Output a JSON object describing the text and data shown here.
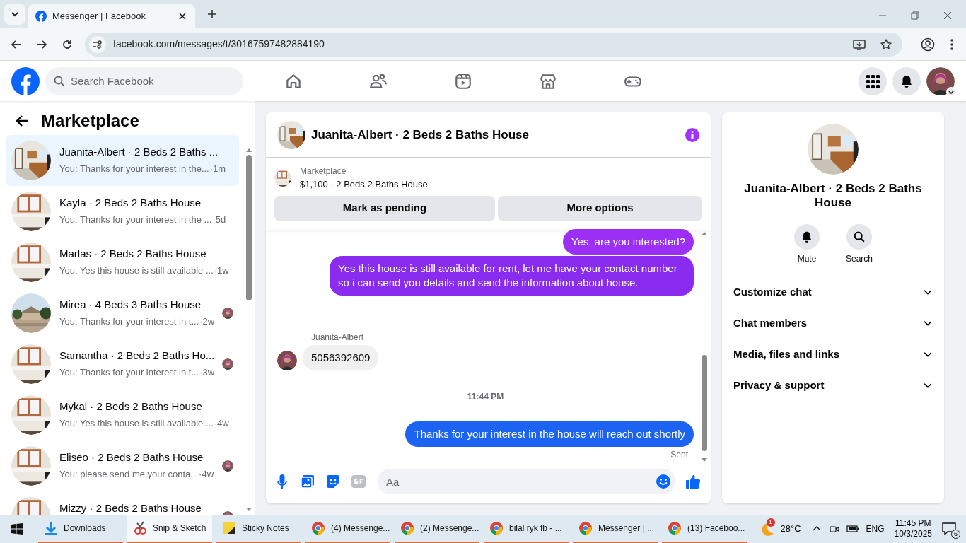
{
  "browser": {
    "tab_title": "Messenger | Facebook",
    "url": "facebook.com/messages/t/30167597482884190"
  },
  "header": {
    "search_placeholder": "Search Facebook"
  },
  "sidebar": {
    "title": "Marketplace",
    "conversations": [
      {
        "title": "Juanita-Albert · 2 Beds 2 Baths ...",
        "preview": "You: Thanks for your interest in the...",
        "time": "·1m",
        "selected": true,
        "seen_by": false
      },
      {
        "title": "Kayla · 2 Beds 2 Baths House",
        "preview": "You: Thanks for your interest in the ...",
        "time": "·5d",
        "selected": false,
        "seen_by": false
      },
      {
        "title": "Marlas · 2 Beds 2 Baths House",
        "preview": "You: Yes this house is still available ...",
        "time": "·1w",
        "selected": false,
        "seen_by": false
      },
      {
        "title": "Mirea · 4 Beds 3 Baths House",
        "preview": "You: Thanks for your interest in t...",
        "time": "·2w",
        "selected": false,
        "seen_by": true
      },
      {
        "title": "Samantha · 2 Beds 2 Baths Ho...",
        "preview": "You: Thanks for your interest in t...",
        "time": "·3w",
        "selected": false,
        "seen_by": true
      },
      {
        "title": "Mykal · 2 Beds 2 Baths House",
        "preview": "You: Yes this house is still available ...",
        "time": "·4w",
        "selected": false,
        "seen_by": false
      },
      {
        "title": "Eliseo · 2 Beds 2 Baths House",
        "preview": "You: please send me your conta...",
        "time": "·4w",
        "selected": false,
        "seen_by": true
      },
      {
        "title": "Mizzy · 2 Beds 2 Baths House",
        "selected": false,
        "seen_by": true
      }
    ]
  },
  "chat": {
    "title": "Juanita-Albert · 2 Beds 2 Baths House",
    "listing": {
      "label": "Marketplace",
      "title": "$1,100 - 2 Beds 2 Baths House"
    },
    "buttons": [
      "Mark as pending",
      "More options"
    ],
    "messages": [
      {
        "kind": "sent",
        "text": "Yes, are you interested?",
        "color": "#9b2ff5"
      },
      {
        "kind": "sent",
        "text": "Yes this house is still available for rent, let me have your contact number so i can send you details and send the information about house.",
        "color": "#8a2cf0"
      },
      {
        "kind": "received",
        "sender": "Juanita-Albert",
        "text": "5056392609"
      },
      {
        "kind": "timestamp",
        "text": "11:44 PM"
      },
      {
        "kind": "sent",
        "text": "Thanks for your interest in the house will reach out shortly",
        "color": "#1c63f2",
        "status": "Sent"
      }
    ],
    "composer": {
      "placeholder": "Aa"
    }
  },
  "details": {
    "title": "Juanita-Albert · 2 Beds 2 Baths House",
    "actions": [
      {
        "kind": "mute",
        "label": "Mute"
      },
      {
        "kind": "search",
        "label": "Search"
      }
    ],
    "sections": [
      {
        "label": "Customize chat",
        "expanded": false
      },
      {
        "label": "Chat members",
        "expanded": false
      },
      {
        "label": "Media, files and links",
        "expanded": false
      },
      {
        "label": "Privacy & support",
        "expanded": false
      }
    ]
  },
  "taskbar": {
    "apps": [
      {
        "kind": "downloads",
        "label": "Downloads",
        "selected": false
      },
      {
        "kind": "snip",
        "label": "Snip & Sketch",
        "selected": true
      },
      {
        "kind": "notes",
        "label": "Sticky Notes",
        "selected": false
      },
      {
        "kind": "chrome",
        "label": "(4) Messenge...",
        "selected": false
      },
      {
        "kind": "chrome",
        "label": "(2) Messenge...",
        "selected": false
      },
      {
        "kind": "chrome",
        "label": "bilal ryk fb - ...",
        "selected": false
      },
      {
        "kind": "chrome",
        "label": "Messenger | ...",
        "selected": false
      },
      {
        "kind": "chrome",
        "label": "(13) Faceboo...",
        "selected": false
      }
    ],
    "weather": {
      "badge": "1",
      "temperature": "28°C"
    },
    "language": "ENG",
    "time": "11:45 PM",
    "date": "10/3/2025",
    "notifications": "6"
  }
}
